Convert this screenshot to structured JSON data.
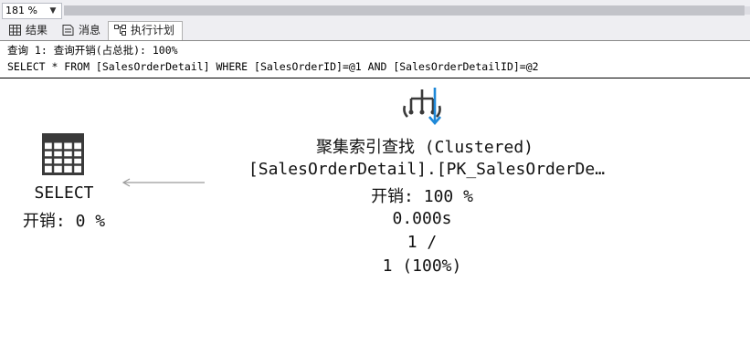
{
  "toolbar": {
    "zoom_value": "181 %"
  },
  "tabs": [
    {
      "label": "结果",
      "icon": "grid-icon"
    },
    {
      "label": "消息",
      "icon": "message-icon"
    },
    {
      "label": "执行计划",
      "icon": "execution-plan-icon"
    }
  ],
  "query": {
    "header": "查询 1: 查询开销(占总批): 100%",
    "sql": "SELECT * FROM [SalesOrderDetail] WHERE [SalesOrderID]=@1 AND [SalesOrderDetailID]=@2"
  },
  "plan": {
    "select_node": {
      "icon": "result-table-icon",
      "label": "SELECT",
      "cost": "开销: 0 %"
    },
    "seek_node": {
      "icon": "clustered-index-seek-icon",
      "title": "聚集索引查找 (Clustered)",
      "object": "[SalesOrderDetail].[PK_SalesOrderDe…",
      "cost": "开销: 100 %",
      "time": "0.000s",
      "rows_actual": "1 /",
      "rows_estimated": "1 (100%)"
    }
  },
  "colors": {
    "seek_arrow_blue": "#1e88d8",
    "icon_dark": "#3a3a3a"
  }
}
